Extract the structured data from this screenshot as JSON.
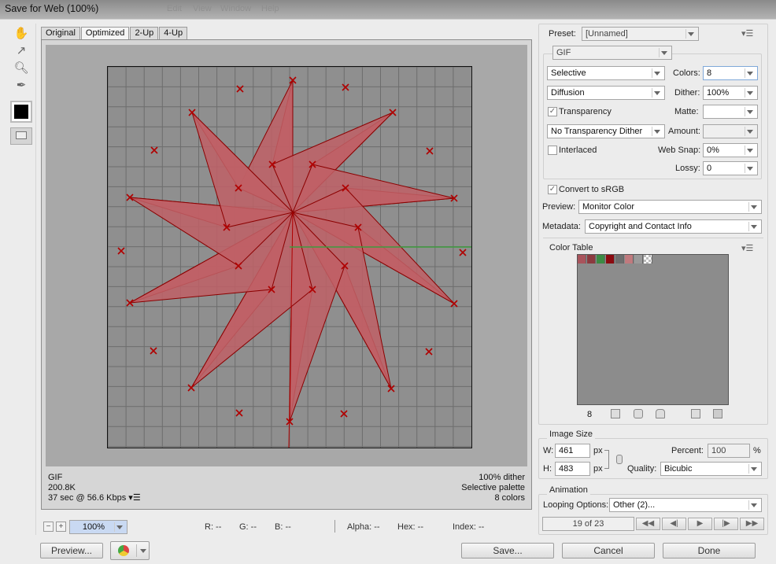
{
  "window": {
    "title": "Save for Web (100%)",
    "ghost_menus": [
      "Edit",
      "View",
      "Window",
      "Help"
    ]
  },
  "tabs": [
    {
      "label": "Original",
      "active": false
    },
    {
      "label": "Optimized",
      "active": true
    },
    {
      "label": "2-Up",
      "active": false
    },
    {
      "label": "4-Up",
      "active": false
    }
  ],
  "tools": [
    "hand-icon",
    "slice-select-icon",
    "zoom-icon",
    "eyedropper-icon"
  ],
  "preview_info": {
    "left": [
      "GIF",
      "200.8K",
      "37 sec @ 56.6 Kbps"
    ],
    "right": [
      "100% dither",
      "Selective palette",
      "8 colors"
    ]
  },
  "zoom": {
    "value": "100%"
  },
  "readouts": {
    "r": "R: --",
    "g": "G: --",
    "b": "B: --",
    "alpha": "Alpha: --",
    "hex": "Hex: --",
    "index": "Index: --"
  },
  "buttons": {
    "preview": "Preview...",
    "save": "Save...",
    "cancel": "Cancel",
    "done": "Done"
  },
  "settings": {
    "preset_label": "Preset:",
    "preset_value": "[Unnamed]",
    "format": "GIF",
    "reduction": "Selective",
    "colors_label": "Colors:",
    "colors_value": "8",
    "dither_algo": "Diffusion",
    "dither_label": "Dither:",
    "dither_value": "100%",
    "transparency_label": "Transparency",
    "transparency_checked": true,
    "matte_label": "Matte:",
    "matte_value": "",
    "trans_dither": "No Transparency Dither",
    "amount_label": "Amount:",
    "amount_value": "",
    "interlaced_label": "Interlaced",
    "interlaced_checked": false,
    "websnap_label": "Web Snap:",
    "websnap_value": "0%",
    "lossy_label": "Lossy:",
    "lossy_value": "0",
    "srgb_label": "Convert to sRGB",
    "srgb_checked": true,
    "preview_label": "Preview:",
    "preview_value": "Monitor Color",
    "metadata_label": "Metadata:",
    "metadata_value": "Copyright and Contact Info"
  },
  "color_table": {
    "title": "Color Table",
    "count": "8",
    "swatches": [
      "#a9545c",
      "#8c3a3f",
      "#3c8a44",
      "#8b0a10",
      "#6e6e6e",
      "#c07a7e",
      "#9a9a9a",
      "checker"
    ]
  },
  "image_size": {
    "title": "Image Size",
    "w_label": "W:",
    "w_value": "461",
    "h_label": "H:",
    "h_value": "483",
    "unit": "px",
    "percent_label": "Percent:",
    "percent_value": "100",
    "percent_unit": "%",
    "quality_label": "Quality:",
    "quality_value": "Bicubic"
  },
  "animation": {
    "title": "Animation",
    "looping_label": "Looping Options:",
    "looping_value": "Other (2)...",
    "frame": "19 of 23"
  },
  "colors": {
    "shape_fill": "#c06066",
    "shape_stroke": "#8b0000",
    "marker": "#b00000",
    "grid": "#6d6d6d",
    "green_line": "#3f9b3f"
  }
}
